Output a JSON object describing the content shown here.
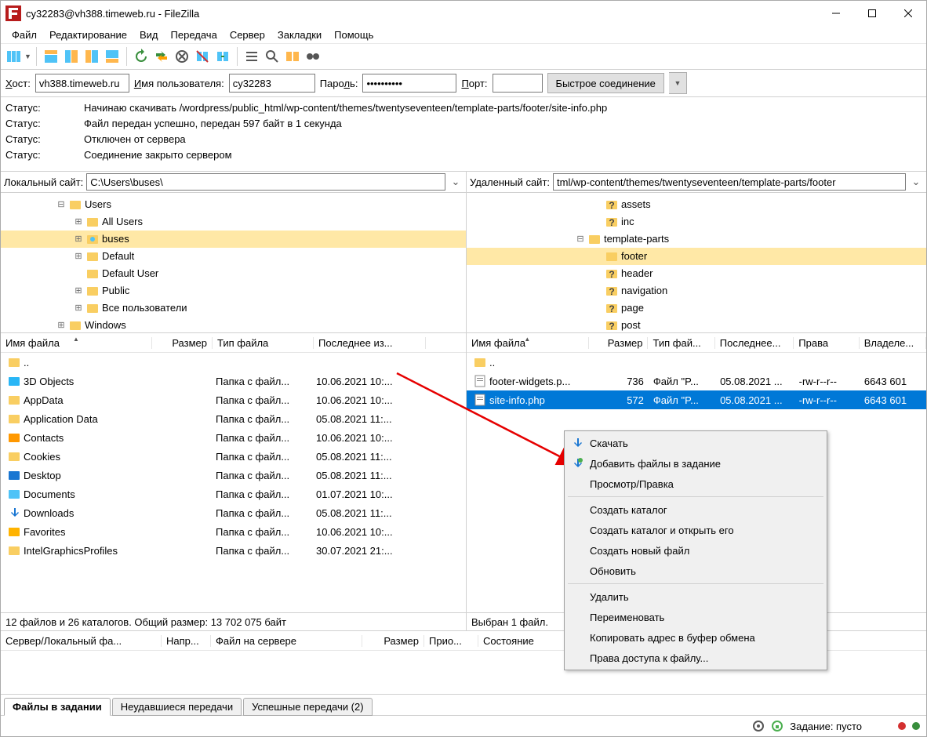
{
  "title": "cy32283@vh388.timeweb.ru - FileZilla",
  "menu": {
    "file": "Файл",
    "edit": "Редактирование",
    "view": "Вид",
    "transfer": "Передача",
    "server": "Сервер",
    "bookmarks": "Закладки",
    "help": "Помощь"
  },
  "quick": {
    "host_lbl": "Хост:",
    "host": "vh388.timeweb.ru",
    "user_lbl": "Имя пользователя:",
    "user": "cy32283",
    "pass_lbl": "Пароль:",
    "pass": "••••••••••",
    "port_lbl": "Порт:",
    "port": "",
    "connect": "Быстрое соединение"
  },
  "log": [
    {
      "lbl": "Статус:",
      "msg": "Начинаю скачивать /wordpress/public_html/wp-content/themes/twentyseventeen/template-parts/footer/site-info.php"
    },
    {
      "lbl": "Статус:",
      "msg": "Файл передан успешно, передан 597 байт в 1 секунда"
    },
    {
      "lbl": "Статус:",
      "msg": "Отключен от сервера"
    },
    {
      "lbl": "Статус:",
      "msg": "Соединение закрыто сервером"
    }
  ],
  "local": {
    "path_lbl": "Локальный сайт:",
    "path": "C:\\Users\\buses\\",
    "tree": [
      {
        "pad": 70,
        "tw": "⊟",
        "icon": "folder",
        "label": "Users"
      },
      {
        "pad": 92,
        "tw": "⊞",
        "icon": "folder",
        "label": "All Users"
      },
      {
        "pad": 92,
        "tw": "⊞",
        "icon": "user",
        "label": "buses",
        "sel": true
      },
      {
        "pad": 92,
        "tw": "⊞",
        "icon": "folder",
        "label": "Default"
      },
      {
        "pad": 92,
        "tw": "",
        "icon": "folder",
        "label": "Default User"
      },
      {
        "pad": 92,
        "tw": "⊞",
        "icon": "folder",
        "label": "Public"
      },
      {
        "pad": 92,
        "tw": "⊞",
        "icon": "folder",
        "label": "Все пользователи"
      },
      {
        "pad": 70,
        "tw": "⊞",
        "icon": "folder",
        "label": "Windows"
      }
    ],
    "cols": {
      "name": "Имя файла",
      "size": "Размер",
      "type": "Тип файла",
      "mod": "Последнее из..."
    },
    "colw": {
      "name": 180,
      "size": 64,
      "type": 116,
      "mod": 130
    },
    "rows": [
      {
        "icon": "folder",
        "name": "..",
        "size": "",
        "type": "",
        "mod": ""
      },
      {
        "icon": "3d",
        "name": "3D Objects",
        "size": "",
        "type": "Папка с файл...",
        "mod": "10.06.2021 10:..."
      },
      {
        "icon": "folder",
        "name": "AppData",
        "size": "",
        "type": "Папка с файл...",
        "mod": "10.06.2021 10:..."
      },
      {
        "icon": "folder",
        "name": "Application Data",
        "size": "",
        "type": "Папка с файл...",
        "mod": "05.08.2021 11:..."
      },
      {
        "icon": "contacts",
        "name": "Contacts",
        "size": "",
        "type": "Папка с файл...",
        "mod": "10.06.2021 10:..."
      },
      {
        "icon": "folder",
        "name": "Cookies",
        "size": "",
        "type": "Папка с файл...",
        "mod": "05.08.2021 11:..."
      },
      {
        "icon": "desktop",
        "name": "Desktop",
        "size": "",
        "type": "Папка с файл...",
        "mod": "05.08.2021 11:..."
      },
      {
        "icon": "docs",
        "name": "Documents",
        "size": "",
        "type": "Папка с файл...",
        "mod": "01.07.2021 10:..."
      },
      {
        "icon": "down",
        "name": "Downloads",
        "size": "",
        "type": "Папка с файл...",
        "mod": "05.08.2021 11:..."
      },
      {
        "icon": "fav",
        "name": "Favorites",
        "size": "",
        "type": "Папка с файл...",
        "mod": "10.06.2021 10:..."
      },
      {
        "icon": "folder",
        "name": "IntelGraphicsProfiles",
        "size": "",
        "type": "Папка с файл...",
        "mod": "30.07.2021 21:..."
      }
    ],
    "status": "12 файлов и 26 каталогов. Общий размер: 13 702 075 байт"
  },
  "remote": {
    "path_lbl": "Удаленный сайт:",
    "path": "tml/wp-content/themes/twentyseventeen/template-parts/footer",
    "tree": [
      {
        "pad": 160,
        "tw": "",
        "icon": "q",
        "label": "assets"
      },
      {
        "pad": 160,
        "tw": "",
        "icon": "q",
        "label": "inc"
      },
      {
        "pad": 138,
        "tw": "⊟",
        "icon": "folder",
        "label": "template-parts"
      },
      {
        "pad": 160,
        "tw": "",
        "icon": "folder",
        "label": "footer",
        "sel": true
      },
      {
        "pad": 160,
        "tw": "",
        "icon": "q",
        "label": "header"
      },
      {
        "pad": 160,
        "tw": "",
        "icon": "q",
        "label": "navigation"
      },
      {
        "pad": 160,
        "tw": "",
        "icon": "q",
        "label": "page"
      },
      {
        "pad": 160,
        "tw": "",
        "icon": "q",
        "label": "post"
      }
    ],
    "cols": {
      "name": "Имя файла",
      "size": "Размер",
      "type": "Тип фай...",
      "mod": "Последнее...",
      "perm": "Права",
      "owner": "Владеле..."
    },
    "colw": {
      "name": 150,
      "size": 66,
      "type": 76,
      "mod": 92,
      "perm": 74,
      "owner": 76
    },
    "rows": [
      {
        "icon": "folder",
        "name": "..",
        "size": "",
        "type": "",
        "mod": "",
        "perm": "",
        "owner": ""
      },
      {
        "icon": "php",
        "name": "footer-widgets.p...",
        "size": "736",
        "type": "Файл \"P...",
        "mod": "05.08.2021 ...",
        "perm": "-rw-r--r--",
        "owner": "6643 601"
      },
      {
        "icon": "php",
        "name": "site-info.php",
        "size": "572",
        "type": "Файл \"P...",
        "mod": "05.08.2021 ...",
        "perm": "-rw-r--r--",
        "owner": "6643 601",
        "sel": true
      }
    ],
    "status": "Выбран 1 файл."
  },
  "queue_cols": {
    "server": "Сервер/Локальный фа...",
    "dir": "Напр...",
    "remote": "Файл на сервере",
    "size": "Размер",
    "prio": "Прио...",
    "state": "Состояние"
  },
  "queue_colw": {
    "server": 192,
    "dir": 50,
    "remote": 180,
    "size": 66,
    "prio": 56,
    "state": 120
  },
  "tabs": {
    "queued": "Файлы в задании",
    "failed": "Неудавшиеся передачи",
    "success": "Успешные передачи (2)"
  },
  "statusbar": {
    "queue": "Задание: пусто"
  },
  "ctx": [
    {
      "label": "Скачать",
      "icon": "down"
    },
    {
      "label": "Добавить файлы в задание",
      "icon": "add"
    },
    {
      "label": "Просмотр/Правка"
    },
    {
      "sep": true
    },
    {
      "label": "Создать каталог"
    },
    {
      "label": "Создать каталог и открыть его"
    },
    {
      "label": "Создать новый файл"
    },
    {
      "label": "Обновить"
    },
    {
      "sep": true
    },
    {
      "label": "Удалить"
    },
    {
      "label": "Переименовать"
    },
    {
      "label": "Копировать адрес в буфер обмена"
    },
    {
      "label": "Права доступа к файлу..."
    }
  ]
}
